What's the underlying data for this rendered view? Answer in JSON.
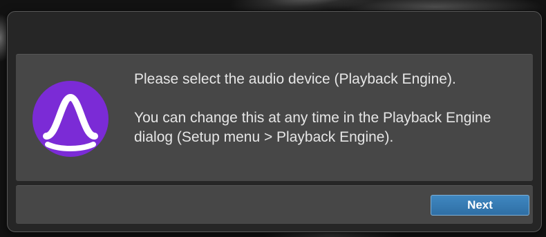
{
  "dialog": {
    "logo_icon": "pro-tools-logo-icon",
    "accent_color": "#7b2bd6",
    "message_line1": "Please select the audio device (Playback Engine).",
    "message_line2": "You can change this at any time in the Playback Engine dialog (Setup menu > Playback Engine).",
    "next_label": "Next",
    "button_color": "#3a7db7"
  }
}
